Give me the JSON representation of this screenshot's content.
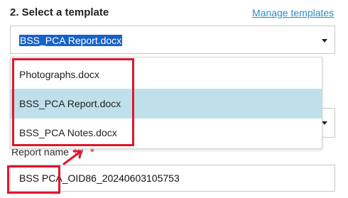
{
  "header": {
    "title": "2. Select a template",
    "manage_link": "Manage templates"
  },
  "template_select": {
    "value": "BSS_PCA Report.docx",
    "options": [
      "Photographs.docx",
      "BSS_PCA Report.docx",
      "BSS_PCA Notes.docx"
    ],
    "selected_index": 1
  },
  "report_name": {
    "label": "Report name",
    "required_mark": "*",
    "info_icon": "info-circle-icon",
    "value": "BSS PCA_OID86_20240603105753"
  },
  "annotations": {
    "color": "#e0162b"
  },
  "colors": {
    "link": "#2b8fc5",
    "selection_highlight": "#1662c8",
    "option_selected_bg": "#bfe0ea"
  }
}
